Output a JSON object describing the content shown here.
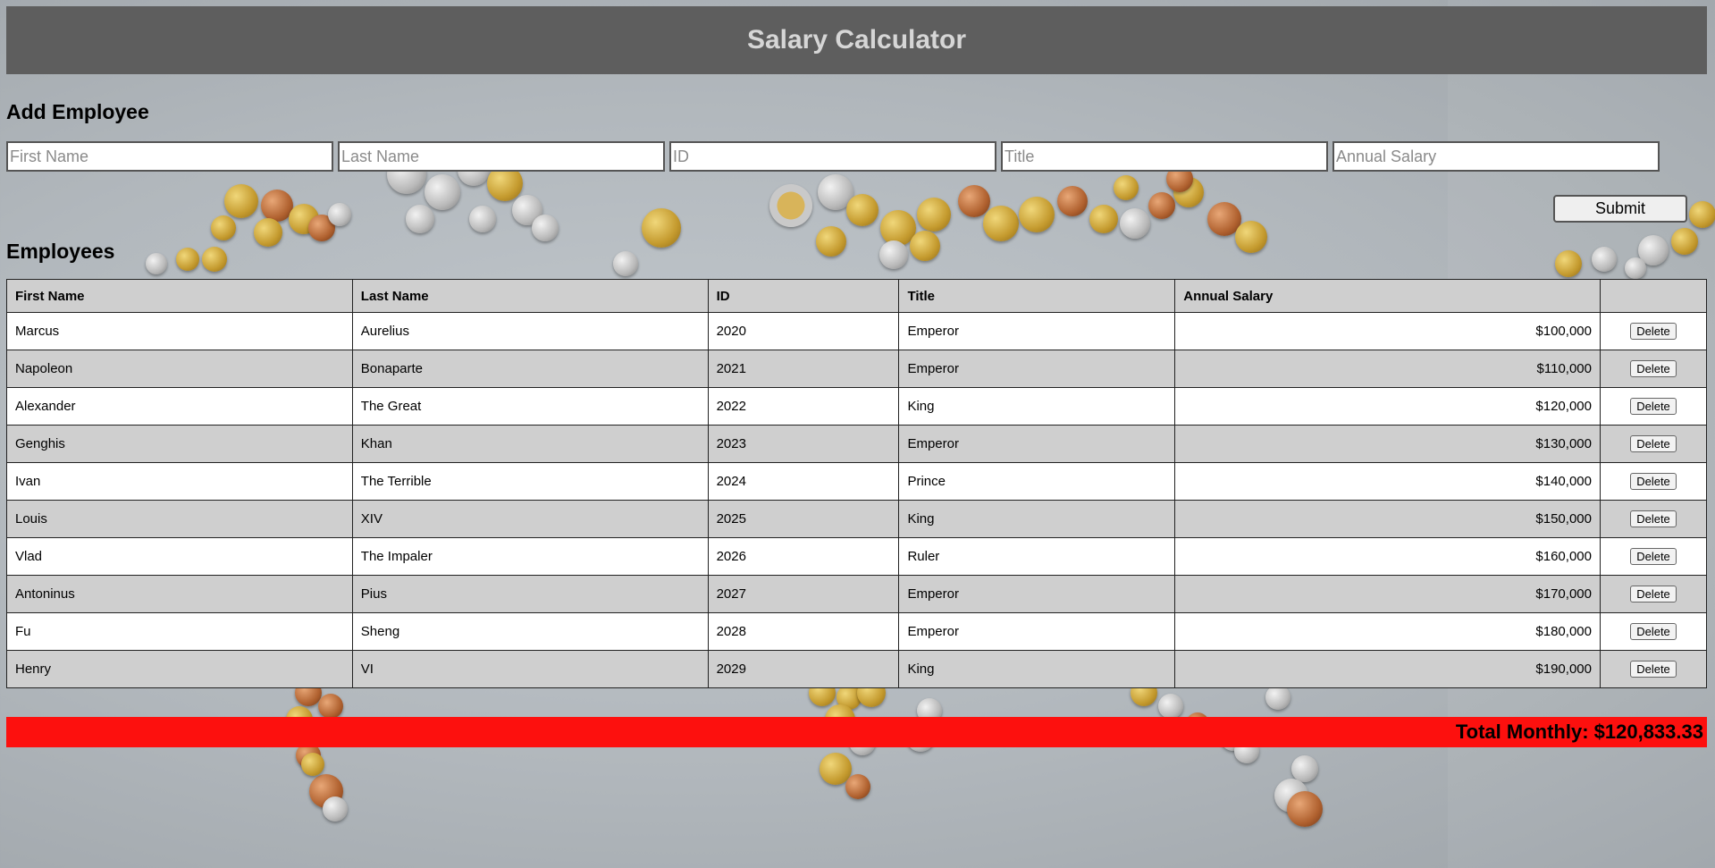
{
  "header": {
    "title": "Salary Calculator"
  },
  "form": {
    "title": "Add Employee",
    "placeholders": {
      "first_name": "First Name",
      "last_name": "Last Name",
      "id": "ID",
      "title": "Title",
      "annual_salary": "Annual Salary"
    },
    "submit_label": "Submit"
  },
  "employees": {
    "title": "Employees",
    "columns": [
      "First Name",
      "Last Name",
      "ID",
      "Title",
      "Annual Salary",
      ""
    ],
    "delete_label": "Delete",
    "rows": [
      {
        "first": "Marcus",
        "last": "Aurelius",
        "id": "2020",
        "title": "Emperor",
        "salary": "$100,000"
      },
      {
        "first": "Napoleon",
        "last": "Bonaparte",
        "id": "2021",
        "title": "Emperor",
        "salary": "$110,000"
      },
      {
        "first": "Alexander",
        "last": "The Great",
        "id": "2022",
        "title": "King",
        "salary": "$120,000"
      },
      {
        "first": "Genghis",
        "last": "Khan",
        "id": "2023",
        "title": "Emperor",
        "salary": "$130,000"
      },
      {
        "first": "Ivan",
        "last": "The Terrible",
        "id": "2024",
        "title": "Prince",
        "salary": "$140,000"
      },
      {
        "first": "Louis",
        "last": "XIV",
        "id": "2025",
        "title": "King",
        "salary": "$150,000"
      },
      {
        "first": "Vlad",
        "last": "The Impaler",
        "id": "2026",
        "title": "Ruler",
        "salary": "$160,000"
      },
      {
        "first": "Antoninus",
        "last": "Pius",
        "id": "2027",
        "title": "Emperor",
        "salary": "$170,000"
      },
      {
        "first": "Fu",
        "last": "Sheng",
        "id": "2028",
        "title": "Emperor",
        "salary": "$180,000"
      },
      {
        "first": "Henry",
        "last": "VI",
        "id": "2029",
        "title": "King",
        "salary": "$190,000"
      }
    ]
  },
  "total": {
    "text": "Total Monthly: $120,833.33",
    "background_color": "#fd100e"
  },
  "colors": {
    "header_bg": "#5e5e5e",
    "header_text": "#d6d6d6",
    "row_alt": "#cfcfcf",
    "row": "#ffffff"
  },
  "background": {
    "description_icon": "coins-background"
  }
}
